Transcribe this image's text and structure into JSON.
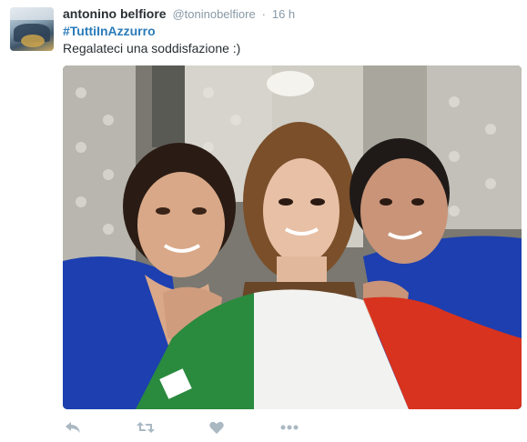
{
  "tweet": {
    "fullname": "antonino belfiore",
    "username": "@toninobelfiore",
    "separator": "·",
    "time": "16 h",
    "hashtag": "#TuttiInAzzurro",
    "text": "Regalateci una soddisfazione :)"
  },
  "photo": {
    "description_icon": "photo-selfie",
    "flag_colors": [
      "#2a8a3e",
      "#f2f2f0",
      "#d8331f"
    ],
    "shirt_color": "#1d3fb0"
  },
  "actions": {
    "icons": [
      "reply-icon",
      "retweet-icon",
      "like-icon",
      "more-icon"
    ],
    "icon_color": "#aab8c2"
  }
}
